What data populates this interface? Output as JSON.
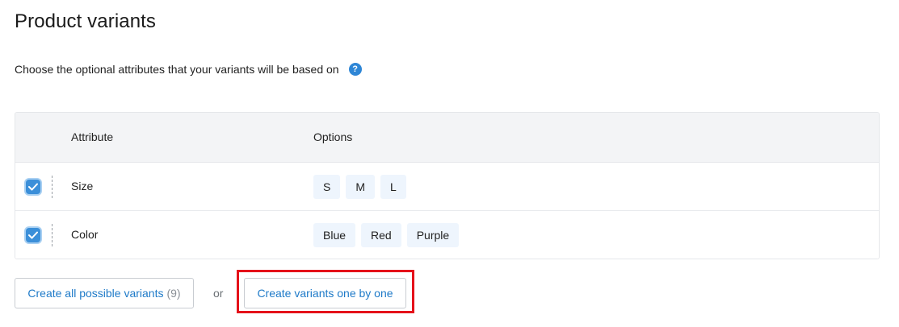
{
  "page": {
    "title": "Product variants",
    "subtitle": "Choose the optional attributes that your variants will be based on",
    "help_icon": "question-mark-icon"
  },
  "table": {
    "headers": {
      "attribute": "Attribute",
      "options": "Options"
    },
    "rows": [
      {
        "name": "Size",
        "checked": true,
        "options": [
          "S",
          "M",
          "L"
        ]
      },
      {
        "name": "Color",
        "checked": true,
        "options": [
          "Blue",
          "Red",
          "Purple"
        ]
      }
    ]
  },
  "actions": {
    "create_all_label": "Create all possible variants",
    "create_all_count": "(9)",
    "or_text": "or",
    "create_one_label": "Create variants one by one"
  },
  "colors": {
    "accent": "#1e7ac8",
    "checkbox": "#3b8fd9",
    "highlight": "#e5121a",
    "chip_bg": "#eef5fd"
  }
}
